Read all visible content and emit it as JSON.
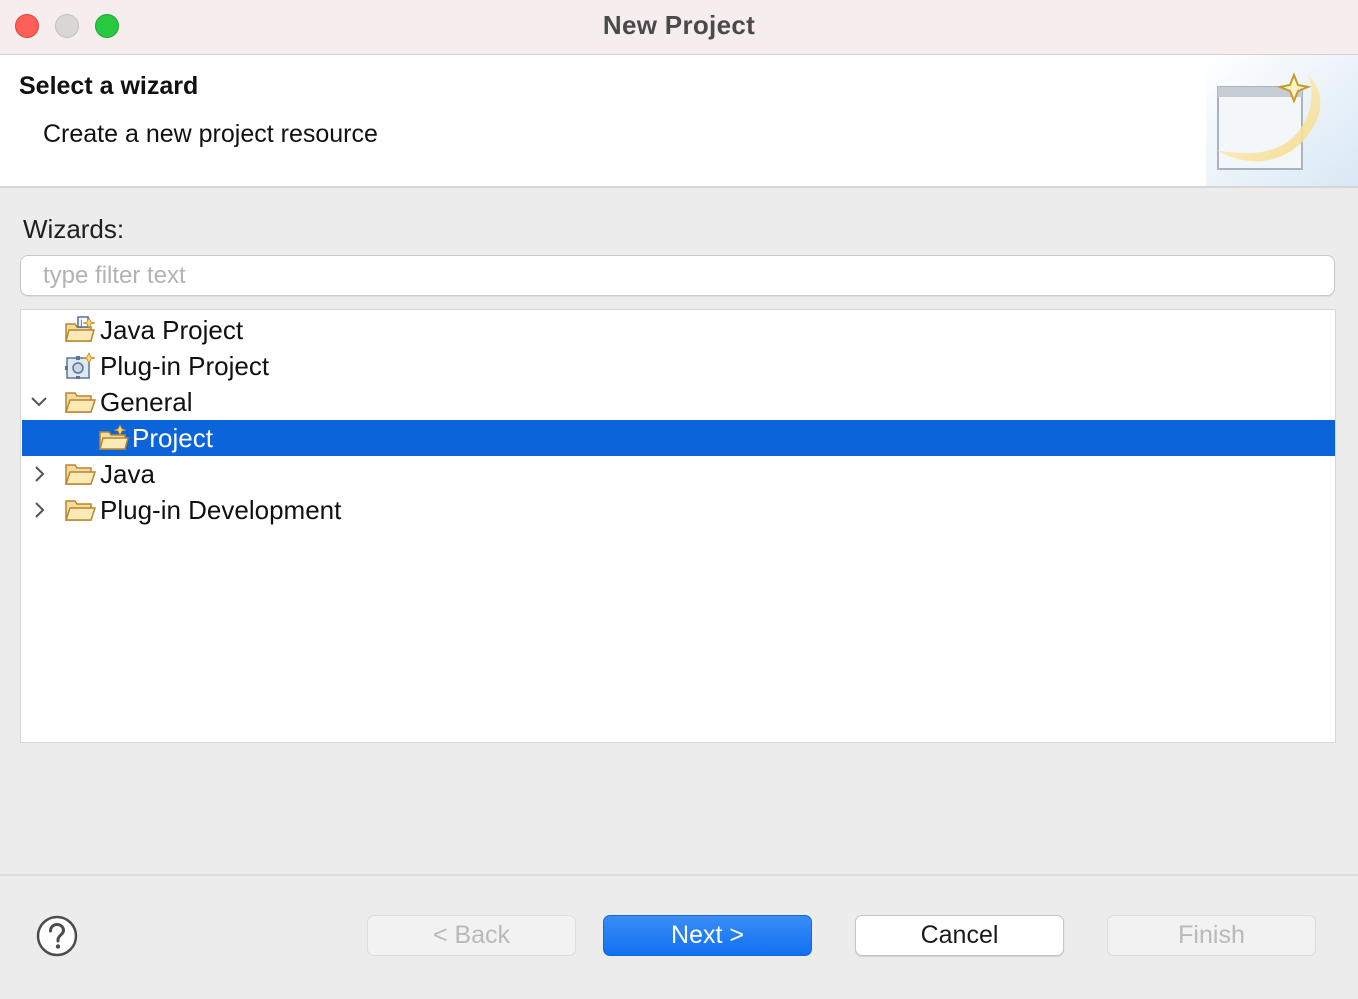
{
  "window": {
    "title": "New Project"
  },
  "banner": {
    "title": "Select a wizard",
    "description": "Create a new project resource"
  },
  "wizards": {
    "label": "Wizards:",
    "filter_placeholder": "type filter text",
    "filter_value": "",
    "tree": [
      {
        "label": "Java Project",
        "icon": "java-project-icon",
        "expandable": false
      },
      {
        "label": "Plug-in Project",
        "icon": "plugin-project-icon",
        "expandable": false
      },
      {
        "label": "General",
        "icon": "folder-open-icon",
        "expandable": true,
        "expanded": true
      },
      {
        "label": "Project",
        "icon": "new-project-icon",
        "expandable": false,
        "selected": true
      },
      {
        "label": "Java",
        "icon": "folder-icon",
        "expandable": true,
        "expanded": false
      },
      {
        "label": "Plug-in Development",
        "icon": "folder-icon",
        "expandable": true,
        "expanded": false
      }
    ]
  },
  "buttons": {
    "back": "< Back",
    "next": "Next >",
    "cancel": "Cancel",
    "finish": "Finish"
  },
  "colors": {
    "selection": "#0b64d9",
    "primary_button": "#1170f0"
  }
}
